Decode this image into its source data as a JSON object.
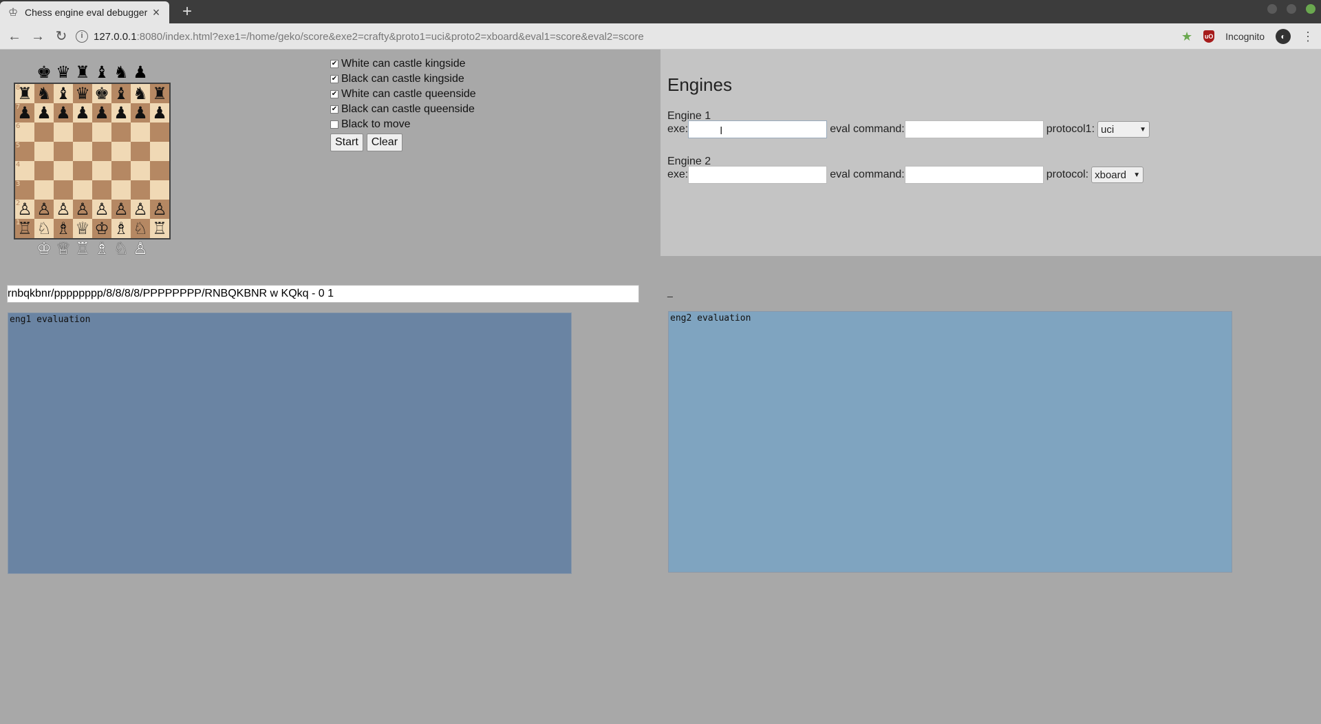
{
  "browser": {
    "tab_title": "Chess engine eval debugger",
    "url_host": "127.0.0.1",
    "url_rest": ":8080/index.html?exe1=/home/geko/score&exe2=crafty&proto1=uci&proto2=xboard&eval1=score&eval2=score",
    "incognito_label": "Incognito"
  },
  "board": {
    "spare_black": [
      "♚",
      "♛",
      "♜",
      "♝",
      "♞",
      "♟"
    ],
    "spare_white": [
      "♔",
      "♕",
      "♖",
      "♗",
      "♘",
      "♙"
    ],
    "squares": [
      [
        "♜",
        "♞",
        "♝",
        "♛",
        "♚",
        "♝",
        "♞",
        "♜"
      ],
      [
        "♟",
        "♟",
        "♟",
        "♟",
        "♟",
        "♟",
        "♟",
        "♟"
      ],
      [
        "",
        "",
        "",
        "",
        "",
        "",
        "",
        ""
      ],
      [
        "",
        "",
        "",
        "",
        "",
        "",
        "",
        ""
      ],
      [
        "",
        "",
        "",
        "",
        "",
        "",
        "",
        ""
      ],
      [
        "",
        "",
        "",
        "",
        "",
        "",
        "",
        ""
      ],
      [
        "♙",
        "♙",
        "♙",
        "♙",
        "♙",
        "♙",
        "♙",
        "♙"
      ],
      [
        "♖",
        "♘",
        "♗",
        "♕",
        "♔",
        "♗",
        "♘",
        "♖"
      ]
    ],
    "rank_labels": [
      "8",
      "7",
      "6",
      "5",
      "4",
      "3",
      "2",
      "1"
    ]
  },
  "options": {
    "white_kingside": {
      "label": "White can castle kingside",
      "checked": true
    },
    "black_kingside": {
      "label": "Black can castle kingside",
      "checked": true
    },
    "white_queenside": {
      "label": "White can castle queenside",
      "checked": true
    },
    "black_queenside": {
      "label": "Black can castle queenside",
      "checked": true
    },
    "black_to_move": {
      "label": "Black to move",
      "checked": false
    },
    "start_label": "Start",
    "clear_label": "Clear"
  },
  "engines": {
    "title": "Engines",
    "engine1": {
      "label": "Engine 1",
      "exe_label": "exe:",
      "eval_label": "eval command:",
      "protocol_label": "protocol1:",
      "protocol": "uci"
    },
    "engine2": {
      "label": "Engine 2",
      "exe_label": "exe:",
      "eval_label": "eval command:",
      "protocol_label": "protocol:",
      "protocol": "xboard"
    }
  },
  "fen": "rnbqkbnr/pppppppp/8/8/8/8/PPPPPPPP/RNBQKBNR w KQkq - 0 1",
  "status_dash": "_",
  "eval1": "eng1 evaluation",
  "eval2": "eng2 evaluation"
}
